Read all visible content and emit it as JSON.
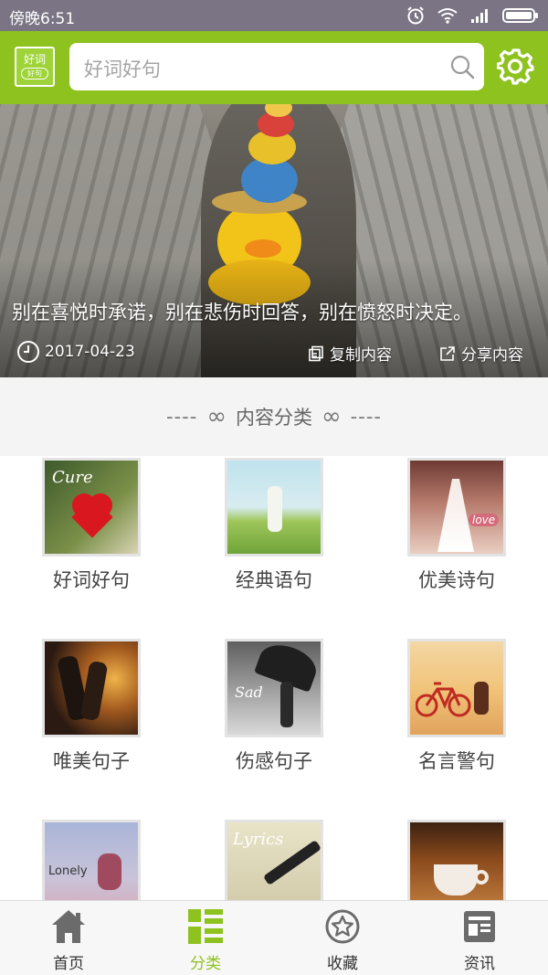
{
  "status_bar": {
    "time": "傍晚6:51"
  },
  "header": {
    "logo_line1": "好词",
    "logo_line2": "好句",
    "search_placeholder": "好词好句"
  },
  "banner": {
    "quote": "别在喜悦时承诺，别在悲伤时回答，别在愤怒时决定。",
    "date": "2017-04-23",
    "copy_label": "复制内容",
    "share_label": "分享内容"
  },
  "section": {
    "title": "内容分类",
    "dashes": "----",
    "infinity": "∞"
  },
  "categories": [
    {
      "label": "好词好句",
      "thumb_text": "Cure"
    },
    {
      "label": "经典语句",
      "thumb_text": ""
    },
    {
      "label": "优美诗句",
      "thumb_text": "love"
    },
    {
      "label": "唯美句子",
      "thumb_text": ""
    },
    {
      "label": "伤感句子",
      "thumb_text": "Sad"
    },
    {
      "label": "名言警句",
      "thumb_text": ""
    },
    {
      "label": "",
      "thumb_text": "Lonely"
    },
    {
      "label": "",
      "thumb_text": "Lyrics"
    },
    {
      "label": "",
      "thumb_text": ""
    }
  ],
  "bottom_nav": [
    {
      "label": "首页",
      "icon": "home-icon",
      "active": false
    },
    {
      "label": "分类",
      "icon": "category-icon",
      "active": true
    },
    {
      "label": "收藏",
      "icon": "star-icon",
      "active": false
    },
    {
      "label": "资讯",
      "icon": "news-icon",
      "active": false
    }
  ],
  "colors": {
    "brand": "#8dc21f",
    "status_bar": "#7b7484"
  }
}
